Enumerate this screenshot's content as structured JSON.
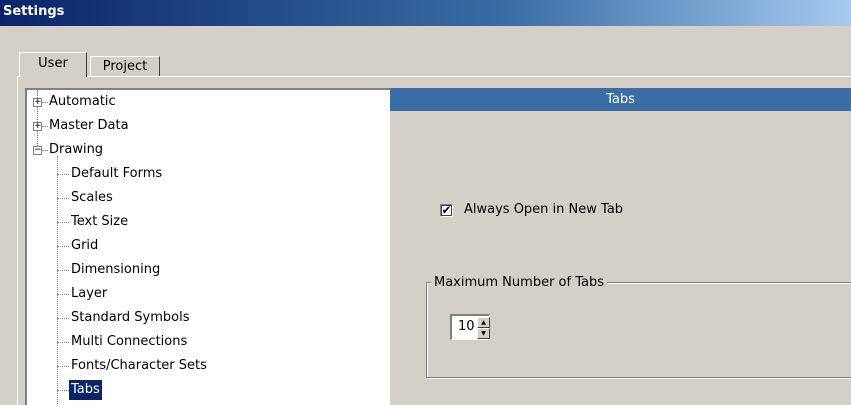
{
  "window": {
    "title": "Settings"
  },
  "tabs": [
    {
      "label": "User",
      "active": true
    },
    {
      "label": "Project",
      "active": false
    }
  ],
  "tree": {
    "items": [
      {
        "label": "Automatic",
        "expander": "+"
      },
      {
        "label": "Master Data",
        "expander": "+"
      },
      {
        "label": "Drawing",
        "expander": "−"
      },
      {
        "label": "Default Forms"
      },
      {
        "label": "Scales"
      },
      {
        "label": "Text Size"
      },
      {
        "label": "Grid"
      },
      {
        "label": "Dimensioning"
      },
      {
        "label": "Layer"
      },
      {
        "label": "Standard Symbols"
      },
      {
        "label": "Multi Connections"
      },
      {
        "label": "Fonts/Character Sets"
      },
      {
        "label": "Tabs",
        "selected": true
      }
    ]
  },
  "panel": {
    "header": "Tabs",
    "always_open_new_tab": {
      "label": "Always Open in New Tab",
      "checked": true,
      "mark": "✔"
    },
    "max_tabs_group": {
      "legend": "Maximum Number of Tabs",
      "value": "10",
      "up_glyph": "▲",
      "down_glyph": "▼"
    }
  },
  "colors": {
    "title_bar": "#0a246a",
    "header_bar": "#3a6ea5",
    "selection": "#0a246a",
    "window_bg": "#d4d0c8"
  }
}
